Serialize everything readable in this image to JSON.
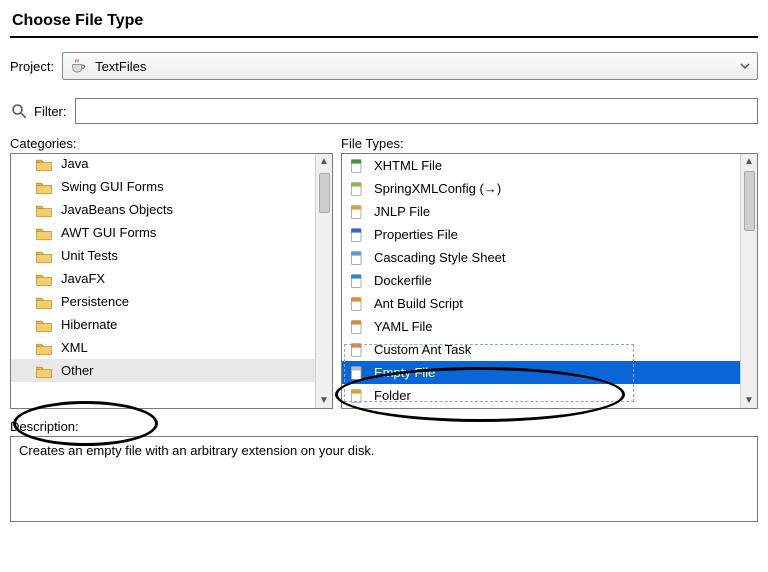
{
  "title": "Choose File Type",
  "projectLabel": "Project:",
  "projectName": "TextFiles",
  "filterLabel": "Filter:",
  "filterValue": "",
  "categoriesLabel": "Categories:",
  "fileTypesLabel": "File Types:",
  "descriptionLabel": "Description:",
  "descriptionText": "Creates an empty file with an arbitrary extension on your disk.",
  "categories": [
    {
      "label": "Java",
      "selected": false
    },
    {
      "label": "Swing GUI Forms",
      "selected": false
    },
    {
      "label": "JavaBeans Objects",
      "selected": false
    },
    {
      "label": "AWT GUI Forms",
      "selected": false
    },
    {
      "label": "Unit Tests",
      "selected": false
    },
    {
      "label": "JavaFX",
      "selected": false
    },
    {
      "label": "Persistence",
      "selected": false
    },
    {
      "label": "Hibernate",
      "selected": false
    },
    {
      "label": "XML",
      "selected": false
    },
    {
      "label": "Other",
      "selected": true
    }
  ],
  "fileTypes": [
    {
      "label": "XHTML File",
      "iconColor": "#3a9440",
      "selected": false
    },
    {
      "label": "SpringXMLConfig (→)",
      "iconColor": "#8fb64a",
      "selected": false
    },
    {
      "label": "JNLP File",
      "iconColor": "#d8a22e",
      "selected": false
    },
    {
      "label": "Properties File",
      "iconColor": "#3766c6",
      "selected": false
    },
    {
      "label": "Cascading Style Sheet",
      "iconColor": "#4aa3d6",
      "selected": false
    },
    {
      "label": "Dockerfile",
      "iconColor": "#2b88c8",
      "selected": false
    },
    {
      "label": "Ant Build Script",
      "iconColor": "#e08b2c",
      "selected": false
    },
    {
      "label": "YAML File",
      "iconColor": "#d68a35",
      "selected": false
    },
    {
      "label": "Custom Ant Task",
      "iconColor": "#d68a35",
      "selected": false
    },
    {
      "label": "Empty File",
      "iconColor": "#bcbcbc",
      "selected": true
    },
    {
      "label": "Folder",
      "iconColor": "#d8a22e",
      "selected": false
    }
  ]
}
